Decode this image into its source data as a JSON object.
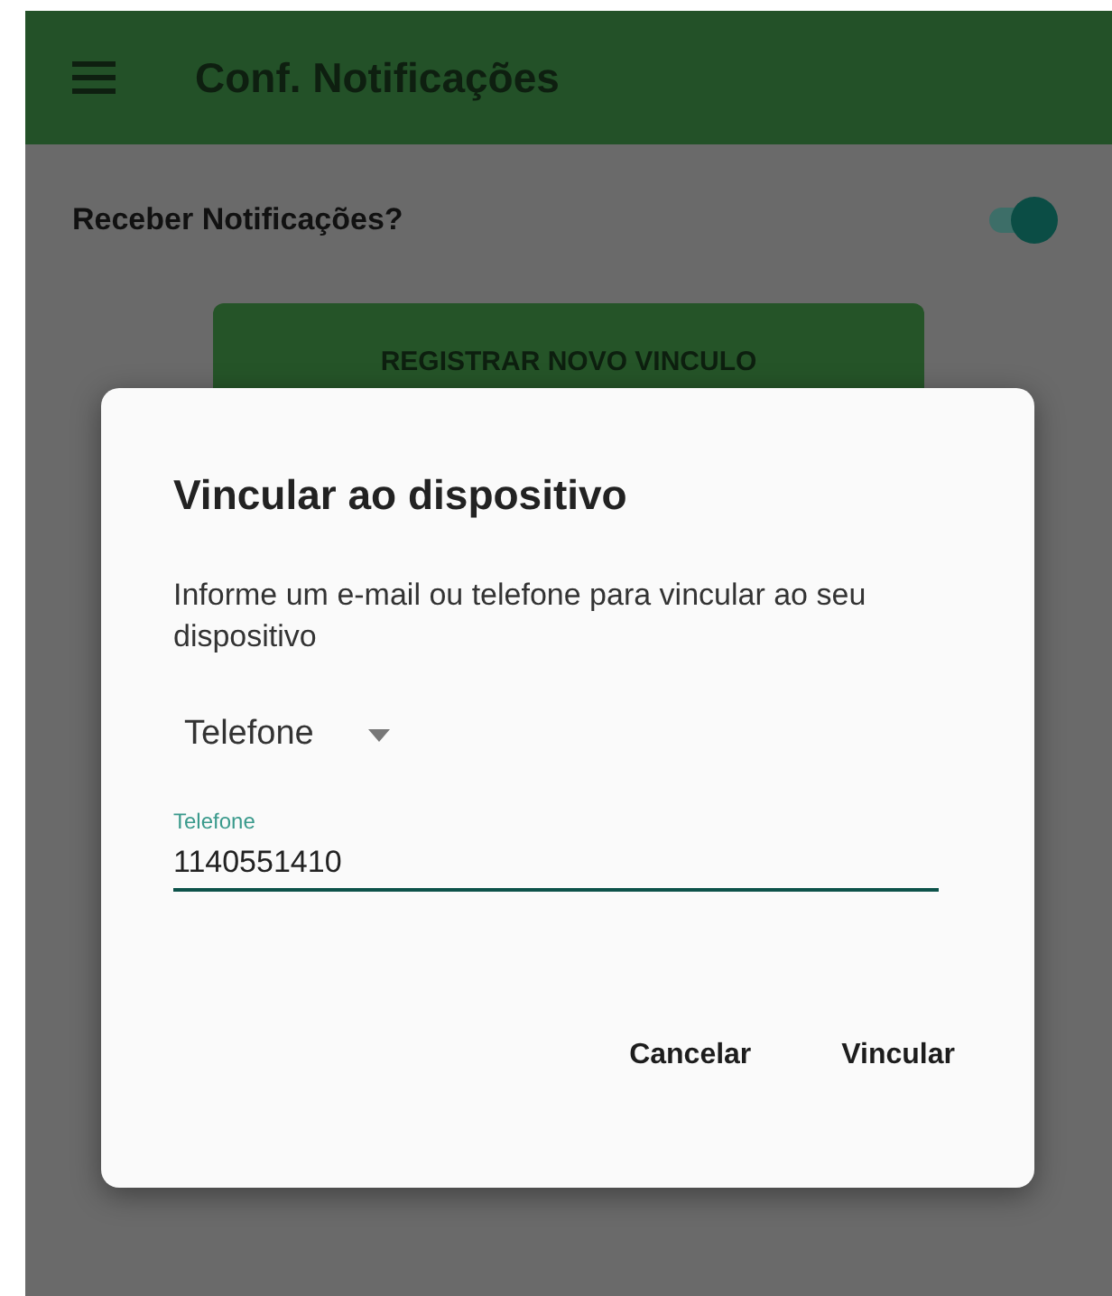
{
  "app_bar": {
    "title": "Conf. Notificações"
  },
  "settings": {
    "label": "Receber Notificações?",
    "on": true
  },
  "register_button": {
    "label": "REGISTRAR NOVO VINCULO"
  },
  "dialog": {
    "title": "Vincular ao dispositivo",
    "message": "Informe um e-mail ou telefone para vincular ao seu dispositivo",
    "dropdown": {
      "value": "Telefone"
    },
    "field": {
      "label": "Telefone",
      "value": "1140551410"
    },
    "buttons": [
      {
        "label": "Cancelar"
      },
      {
        "label": "Vincular"
      }
    ]
  }
}
